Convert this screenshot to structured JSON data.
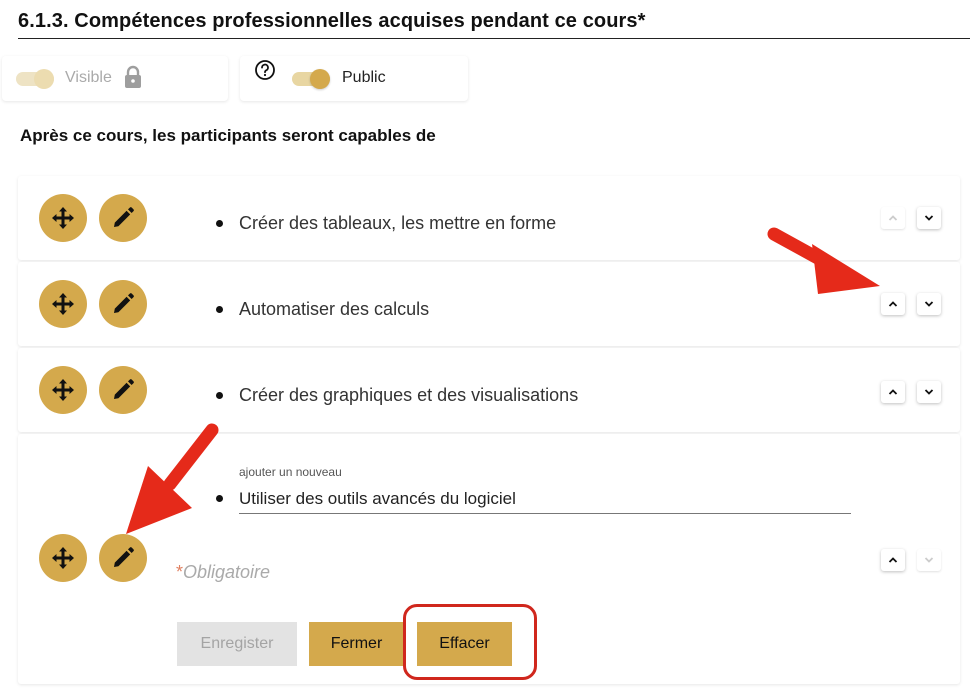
{
  "section": {
    "title": "6.1.3. Compétences professionnelles acquises pendant ce cours*"
  },
  "visibility": {
    "visible_label": "Visible",
    "public_label": "Public"
  },
  "subheading": "Après ce cours, les participants seront capables de",
  "items": [
    {
      "text": "Créer des tableaux, les mettre en forme"
    },
    {
      "text": "Automatiser des calculs"
    },
    {
      "text": "Créer des graphiques et des visualisations"
    }
  ],
  "new_item": {
    "label": "ajouter un nouveau",
    "value": "Utiliser des outils avancés du logiciel",
    "required_mark": "*",
    "required_text": "Obligatoire"
  },
  "buttons": {
    "save": "Enregister",
    "close": "Fermer",
    "clear": "Effacer"
  },
  "icons": {
    "move": "move-arrows-icon",
    "edit": "pencil-icon",
    "up": "chevron-up-icon",
    "down": "chevron-down-icon",
    "lock": "lock-icon",
    "help": "question-circle-icon"
  },
  "colors": {
    "accent": "#d4a94c",
    "annotation": "#e52a1a",
    "disabled": "#e3e3e3"
  }
}
